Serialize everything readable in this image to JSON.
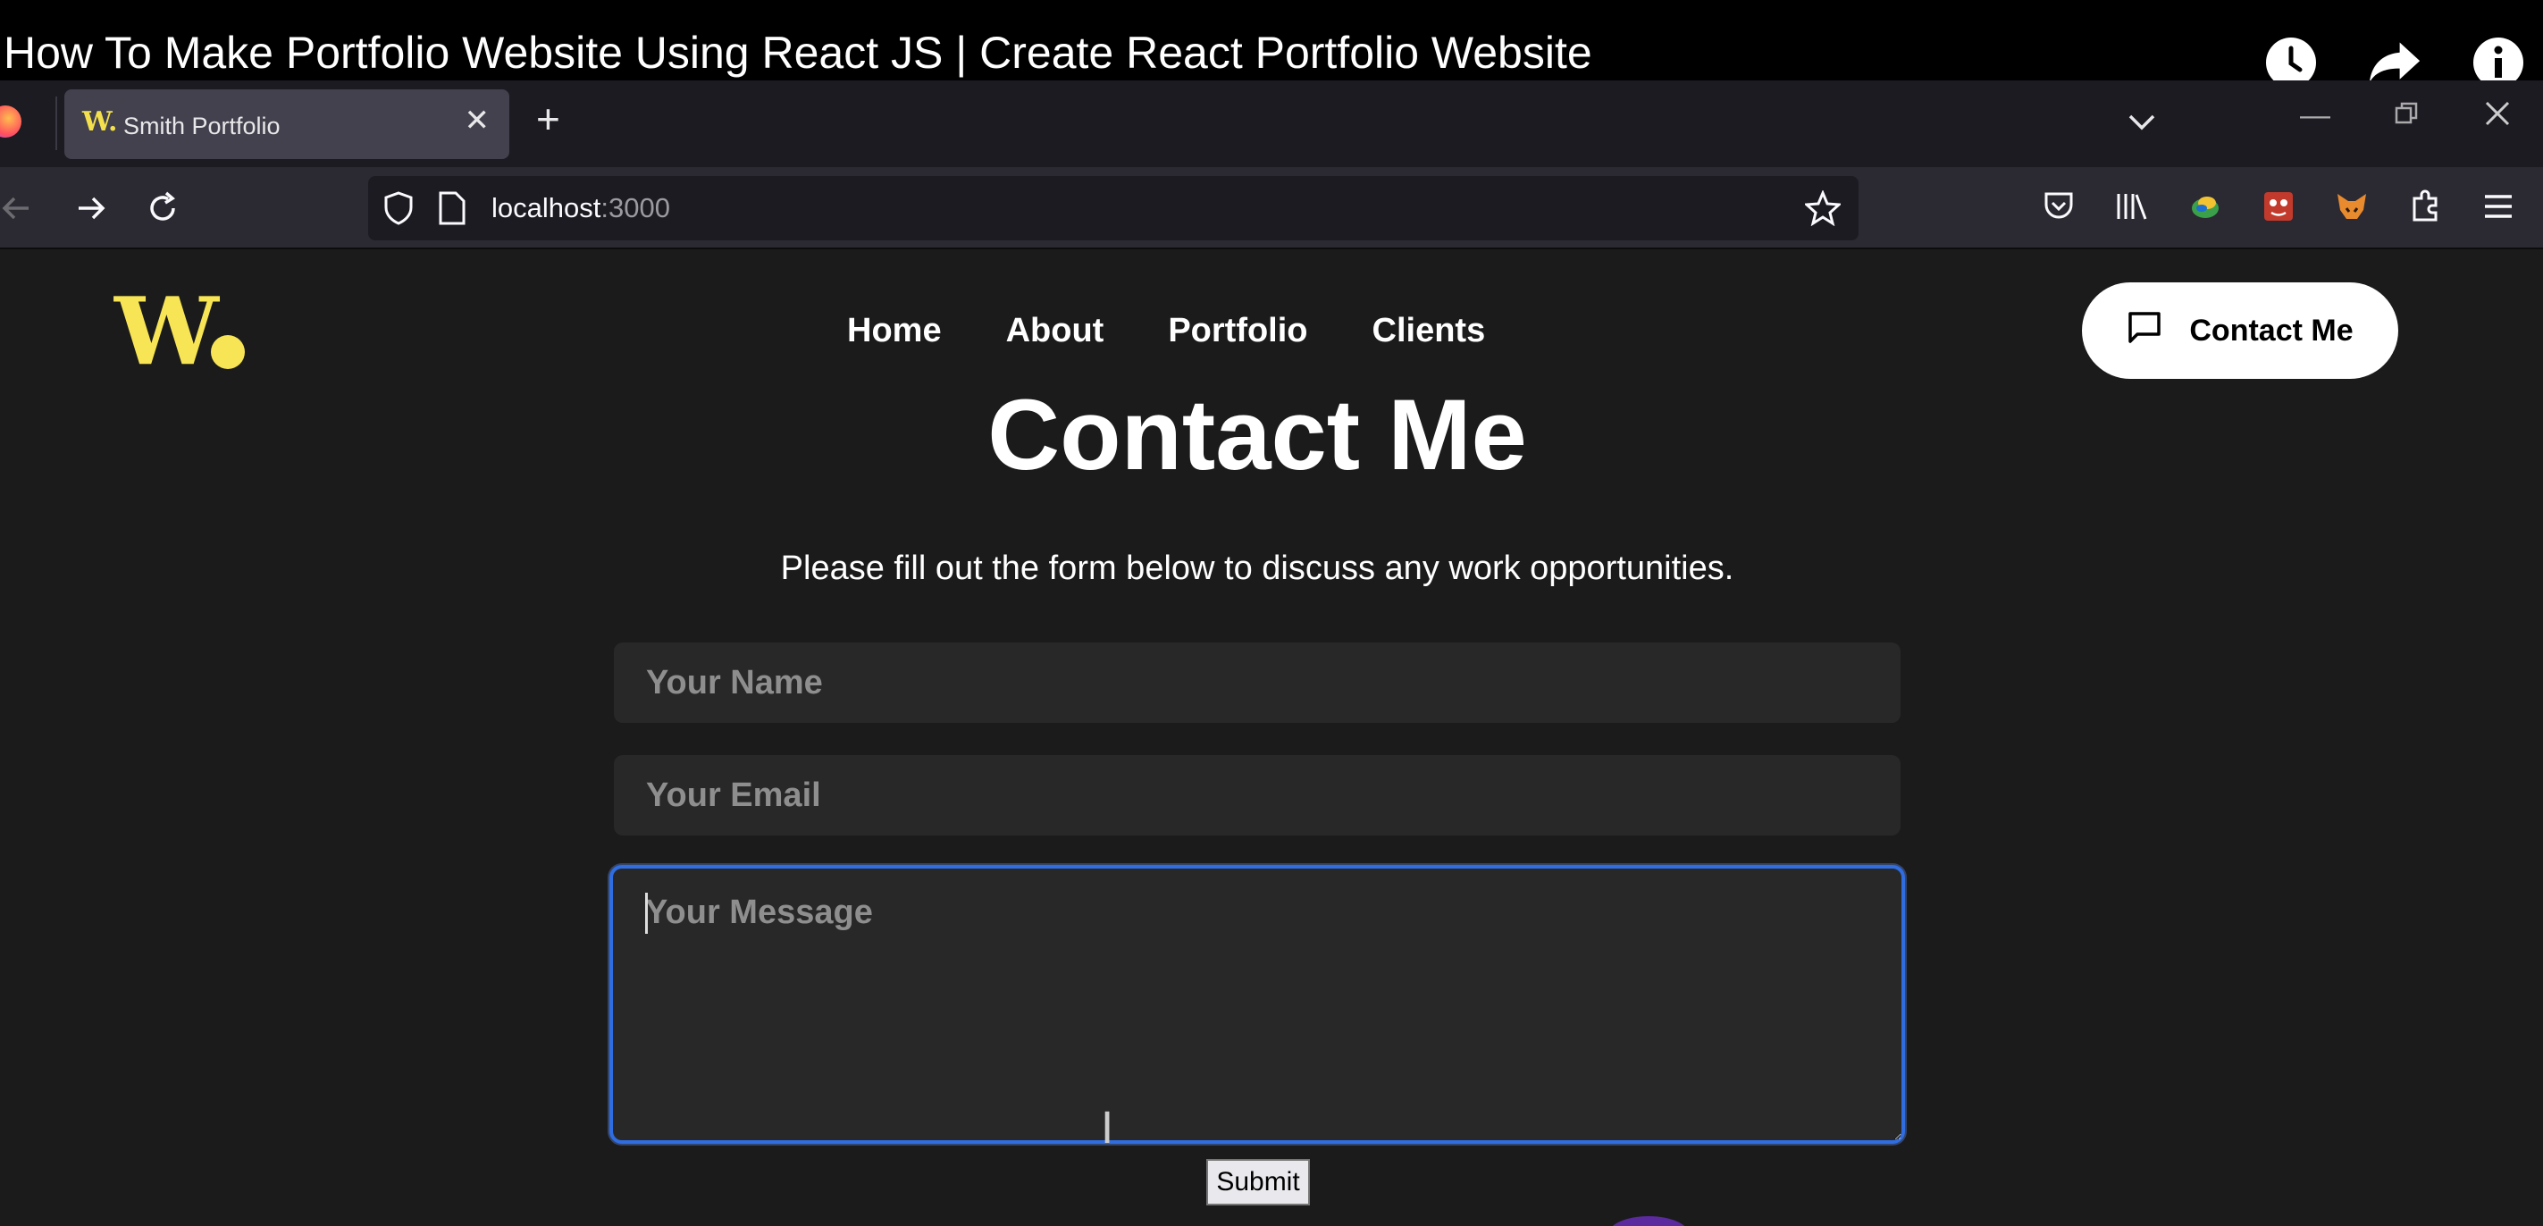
{
  "video": {
    "title": "How To Make Portfolio Website Using React JS | Create React Portfolio Website",
    "icons": [
      "clock-icon",
      "share-icon",
      "info-icon"
    ]
  },
  "browser": {
    "tab": {
      "title": "Smith Portfolio",
      "favicon": "W."
    },
    "url": {
      "host": "localhost",
      "port": ":3000"
    },
    "toolbar_icons": [
      "pocket-icon",
      "library-icon",
      "extension-globe-icon",
      "extension-red-icon",
      "metamask-fox-icon",
      "extensions-puzzle-icon",
      "menu-icon"
    ]
  },
  "site": {
    "logo": "W",
    "nav": [
      "Home",
      "About",
      "Portfolio",
      "Clients"
    ],
    "contact_button": "Contact Me",
    "heading": "Contact Me",
    "subtitle": "Please fill out the form below to discuss any work opportunities.",
    "form": {
      "name_placeholder": "Your Name",
      "email_placeholder": "Your Email",
      "message_placeholder": "Your Message",
      "submit_label": "Submit"
    },
    "colors": {
      "accent": "#f7e555",
      "background": "#1b1b1b",
      "field": "#282828",
      "focus": "#2f6de1"
    }
  }
}
